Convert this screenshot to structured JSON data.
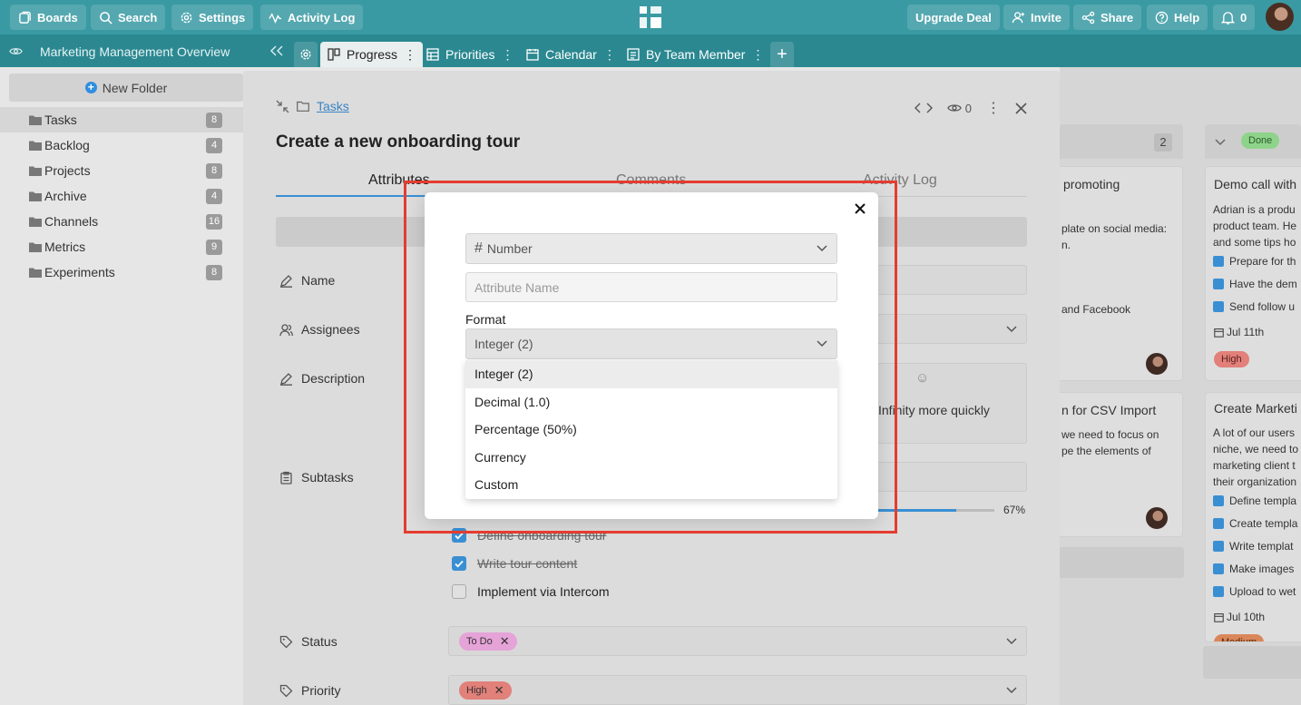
{
  "topbar": {
    "boards": "Boards",
    "search": "Search",
    "settings": "Settings",
    "activity_log": "Activity Log",
    "upgrade": "Upgrade Deal",
    "invite": "Invite",
    "share": "Share",
    "help": "Help",
    "notifications": "0"
  },
  "tabbar": {
    "board_title": "Marketing Management Overview",
    "tabs": [
      {
        "label": "Progress"
      },
      {
        "label": "Priorities"
      },
      {
        "label": "Calendar"
      },
      {
        "label": "By Team Member"
      }
    ],
    "add": "+"
  },
  "sidebar": {
    "new_folder": "New Folder",
    "folders": [
      {
        "label": "Tasks",
        "count": "8"
      },
      {
        "label": "Backlog",
        "count": "4"
      },
      {
        "label": "Projects",
        "count": "8"
      },
      {
        "label": "Archive",
        "count": "4"
      },
      {
        "label": "Channels",
        "count": "16"
      },
      {
        "label": "Metrics",
        "count": "9"
      },
      {
        "label": "Experiments",
        "count": "8"
      }
    ]
  },
  "board": {
    "col1_count": "2",
    "col2_tag": "Done",
    "card1_title": "promoting",
    "card1_line1": "plate on social media:",
    "card1_line2": "n.",
    "card1_line3": "and Facebook",
    "card2_title": "n for CSV Import",
    "card2_line1": "we need to focus on",
    "card2_line2": "pe the elements of",
    "card3_title": "Demo call with",
    "card3_lines": [
      "Adrian is a produ",
      "product team. He",
      "and some tips ho"
    ],
    "card3_checks": [
      "Prepare for th",
      "Have the dem",
      "Send follow u"
    ],
    "card3_date": "Jul 11th",
    "card3_tag": "High",
    "card4_title": "Create Marketi",
    "card4_lines": [
      "A lot of our users",
      "niche, we need to",
      "marketing client t",
      "their organization"
    ],
    "card4_checks": [
      "Define templa",
      "Create templa",
      "Write templat",
      "Make images",
      "Upload to wet"
    ],
    "card4_date": "Jul 10th",
    "card4_tag": "Medium"
  },
  "panel": {
    "crumb": "Tasks",
    "title": "Create a new onboarding tour",
    "watchers": "0",
    "tabs": {
      "attributes": "Attributes",
      "comments": "Comments",
      "activity": "Activity Log"
    },
    "fields": {
      "name": "Name",
      "assignees": "Assignees",
      "description": "Description",
      "description_text": "Infinity more quickly",
      "subtasks": "Subtasks",
      "status": "Status",
      "priority": "Priority"
    },
    "progress": "67%",
    "progress_value": 0.67,
    "subtasks": [
      {
        "label": "Define onboarding tour",
        "done": true
      },
      {
        "label": "Write tour content",
        "done": true
      },
      {
        "label": "Implement via Intercom",
        "done": false
      }
    ],
    "status_tag": "To Do",
    "priority_tag": "High"
  },
  "modal": {
    "type_label": "Number",
    "name_placeholder": "Attribute Name",
    "format_label": "Format",
    "format_value": "Integer (2)",
    "options": [
      "Integer (2)",
      "Decimal (1.0)",
      "Percentage (50%)",
      "Currency",
      "Custom"
    ]
  },
  "colors": {
    "topbar": "#3a9aa3",
    "tabbar": "#2b8891",
    "accent": "#3a8fd3",
    "highlight": "#e53c2f"
  }
}
